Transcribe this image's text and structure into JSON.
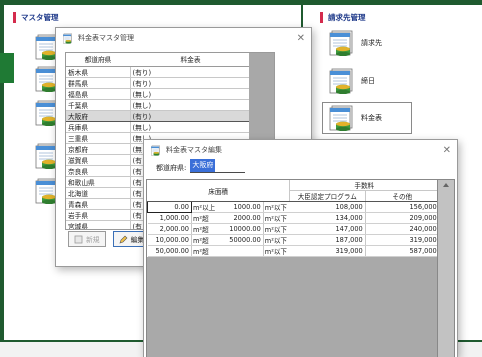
{
  "background": {
    "left_section_title": "マスタ管理",
    "right_section_title": "請求先管理",
    "right_items": [
      {
        "label": "請求先"
      },
      {
        "label": "締日"
      },
      {
        "label": "料金表"
      }
    ]
  },
  "window_list": {
    "title": "料金表マスタ管理",
    "columns": [
      "都道府県",
      "料金表"
    ],
    "rows": [
      {
        "pref": "栃木県",
        "fee": "(有り)"
      },
      {
        "pref": "群馬県",
        "fee": "(有り)"
      },
      {
        "pref": "福島県",
        "fee": "(無し)"
      },
      {
        "pref": "千葉県",
        "fee": "(無し)"
      },
      {
        "pref": "大阪府",
        "fee": "(有り)"
      },
      {
        "pref": "兵庫県",
        "fee": "(無し)"
      },
      {
        "pref": "三重県",
        "fee": "(無し)"
      },
      {
        "pref": "京都府",
        "fee": "(無"
      },
      {
        "pref": "滋賀県",
        "fee": "(有"
      },
      {
        "pref": "奈良県",
        "fee": "(有"
      },
      {
        "pref": "和歌山県",
        "fee": "(有"
      },
      {
        "pref": "北海道",
        "fee": "(有"
      },
      {
        "pref": "青森県",
        "fee": "(有"
      },
      {
        "pref": "岩手県",
        "fee": "(有"
      },
      {
        "pref": "宮城県",
        "fee": "(有"
      },
      {
        "pref": "秋田県",
        "fee": "(有"
      }
    ],
    "selected_index": 4,
    "new_button": "新規",
    "edit_button": "編集"
  },
  "window_edit": {
    "title": "料金表マスタ編集",
    "field_label": "都道府県:",
    "field_value": "大阪府",
    "header": {
      "area": "床面積",
      "fee_group": "手数料",
      "fee_program": "大臣認定プログラム",
      "fee_other": "その他"
    },
    "rows": [
      {
        "from": "0.00",
        "from_unit": "m²以上",
        "to": "1000.00",
        "to_unit": "m²以下",
        "program": "108,000",
        "other": "156,000"
      },
      {
        "from": "1,000.00",
        "from_unit": "m²超",
        "to": "2000.00",
        "to_unit": "m²以下",
        "program": "134,000",
        "other": "209,000"
      },
      {
        "from": "2,000.00",
        "from_unit": "m²超",
        "to": "10000.00",
        "to_unit": "m²以下",
        "program": "147,000",
        "other": "240,000"
      },
      {
        "from": "10,000.00",
        "from_unit": "m²超",
        "to": "50000.00",
        "to_unit": "m²以下",
        "program": "187,000",
        "other": "319,000"
      },
      {
        "from": "50,000.00",
        "from_unit": "m²超",
        "to": "",
        "to_unit": "m²以下",
        "program": "319,000",
        "other": "587,000"
      }
    ]
  },
  "colors": {
    "brand_green": "#1f5a2f",
    "section_marker": "#d42b4d",
    "section_title": "#1f3a8a",
    "selection_blue": "#3a6fd8"
  }
}
